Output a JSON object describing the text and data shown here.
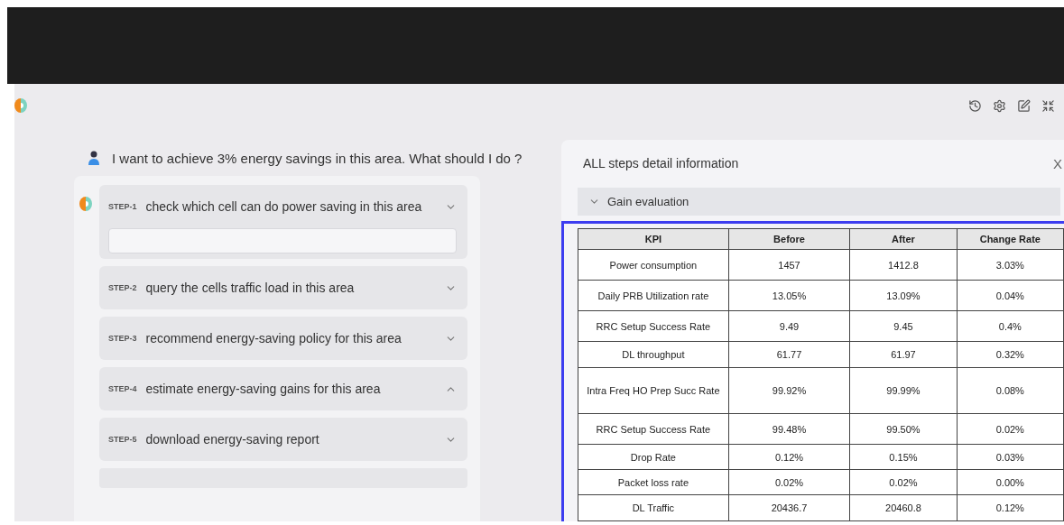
{
  "question": "I want to achieve 3% energy savings in this area. What should I do ?",
  "steps": [
    {
      "tag": "STEP-1",
      "text": "check which cell can do power saving in this area",
      "expanded": false,
      "body_open": true
    },
    {
      "tag": "STEP-2",
      "text": "query the cells traffic load in this area",
      "expanded": false,
      "body_open": false
    },
    {
      "tag": "STEP-3",
      "text": "recommend energy-saving policy for this area",
      "expanded": false,
      "body_open": false
    },
    {
      "tag": "STEP-4",
      "text": "estimate energy-saving gains for this area",
      "expanded": true,
      "body_open": false
    },
    {
      "tag": "STEP-5",
      "text": "download energy-saving report",
      "expanded": false,
      "body_open": false
    }
  ],
  "detail": {
    "title": "ALL steps detail information",
    "close": "X",
    "section": {
      "label": "Gain evaluation",
      "expanded": true
    },
    "table": {
      "columns": [
        "KPI",
        "Before",
        "After",
        "Change Rate"
      ],
      "rows": [
        [
          "Power consumption",
          "1457",
          "1412.8",
          "3.03%"
        ],
        [
          "Daily PRB Utilization rate",
          "13.05%",
          "13.09%",
          "0.04%"
        ],
        [
          "RRC Setup Success Rate",
          "9.49",
          "9.45",
          "0.4%"
        ],
        [
          "DL throughput",
          "61.77",
          "61.97",
          "0.32%"
        ],
        [
          "Intra Freq HO Prep Succ  Rate",
          "99.92%",
          "99.99%",
          "0.08%"
        ],
        [
          "RRC Setup Success Rate",
          "99.48%",
          "99.50%",
          "0.02%"
        ],
        [
          "Drop Rate",
          "0.12%",
          "0.15%",
          "0.03%"
        ],
        [
          "Packet loss rate",
          "0.02%",
          "0.02%",
          "0.00%"
        ],
        [
          "DL Traffic",
          "20436.7",
          "20460.8",
          "0.12%"
        ]
      ]
    }
  }
}
